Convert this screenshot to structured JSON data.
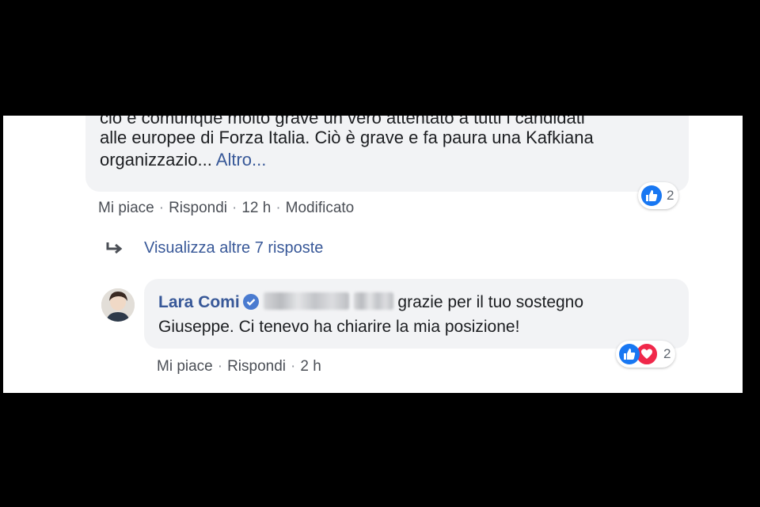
{
  "comment1": {
    "lines": [
      "ciò è comunque molto grave un vero attentato a tutti i candidati",
      "alle europee di Forza Italia. Ciò è grave e fa paura una Kafkiana",
      "organizzazio..."
    ],
    "more_link": "Altro...",
    "reaction_count": "2",
    "actions": {
      "like": "Mi piace",
      "reply": "Rispondi",
      "time": "12 h",
      "edited": "Modificato"
    }
  },
  "more_replies": {
    "label": "Visualizza altre 7 risposte"
  },
  "reply": {
    "author": "Lara Comi",
    "text_line1": "grazie per il tuo sostegno",
    "text_line2": "Giuseppe. Ci tenevo ha chiarire la mia posizione!",
    "reaction_count": "2",
    "actions": {
      "like": "Mi piace",
      "reply": "Rispondi",
      "time": "2 h"
    }
  },
  "colors": {
    "link_blue": "#385898",
    "bubble_bg": "#f2f3f5",
    "like_blue": "#1877f2",
    "love_red": "#f0284a"
  }
}
